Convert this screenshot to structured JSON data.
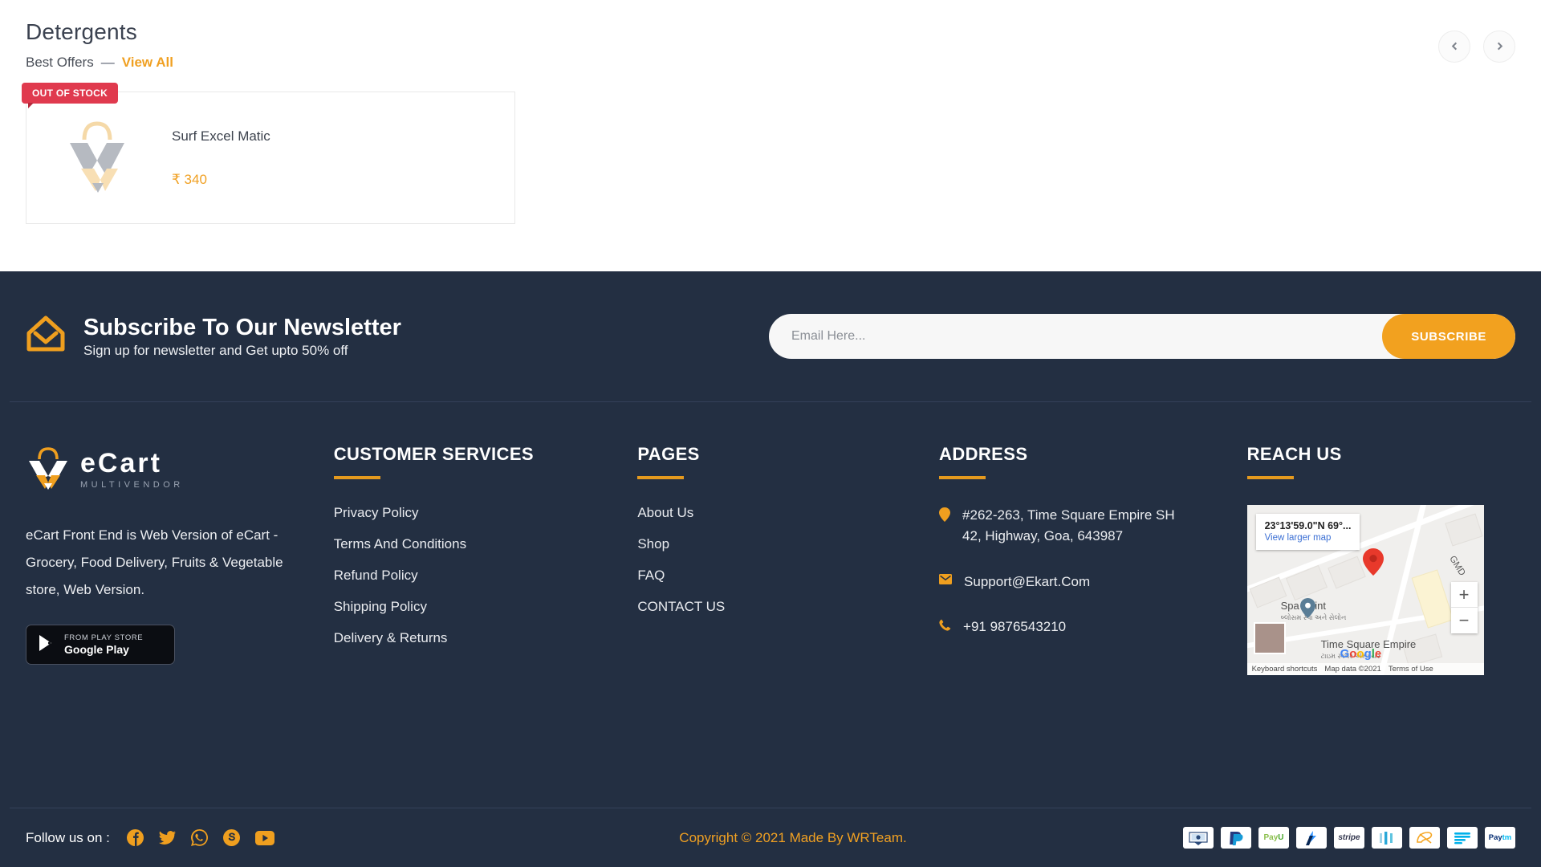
{
  "section": {
    "title": "Detergents",
    "subtitle": "Best Offers",
    "dash": "—",
    "view_all": "View All",
    "prev_label": "Previous",
    "next_label": "Next"
  },
  "products": [
    {
      "badge": "OUT OF STOCK",
      "name": "Surf Excel Matic",
      "price": "₹ 340"
    }
  ],
  "newsletter": {
    "title": "Subscribe To Our Newsletter",
    "subtitle": "Sign up for newsletter and Get upto 50% off",
    "placeholder": "Email Here...",
    "value": "",
    "button": "SUBSCRIBE"
  },
  "brand": {
    "name": "eCart",
    "tagline": "MULTIVENDOR",
    "description": "eCart Front End is Web Version of eCart - Grocery, Food Delivery, Fruits & Vegetable store, Web Version.",
    "play_small": "FROM PLAY STORE",
    "play_large": "Google Play"
  },
  "customer_services": {
    "heading": "CUSTOMER SERVICES",
    "links": [
      "Privacy Policy",
      "Terms And Conditions",
      "Refund Policy",
      "Shipping Policy",
      "Delivery & Returns"
    ]
  },
  "pages": {
    "heading": "PAGES",
    "links": [
      "About Us",
      "Shop",
      "FAQ",
      "CONTACT US"
    ]
  },
  "address": {
    "heading": "ADDRESS",
    "street": "#262-263, Time Square Empire SH 42, Highway, Goa, 643987",
    "email": "Support@Ekart.Com",
    "phone": "+91 9876543210"
  },
  "reach_us": {
    "heading": "REACH US",
    "map": {
      "coordinates": "23°13'59.0\"N 69°...",
      "view_larger": "View larger map",
      "place_label": "Time Square Empire",
      "place_label_local": "ટાઇમ સ્ક્વેર એમ્પાયર",
      "spa_label": "Spa Point",
      "spa_label_local": "બ્લોસમ સ્પા અને સેલોન",
      "road_label": "GMD",
      "zoom_in": "+",
      "zoom_out": "−",
      "keyboard_shortcuts": "Keyboard shortcuts",
      "map_data": "Map data ©2021",
      "terms": "Terms of Use",
      "google": "Google"
    }
  },
  "bottom": {
    "follow_label": "Follow us on :",
    "socials": [
      "facebook-icon",
      "twitter-icon",
      "whatsapp-icon",
      "skype-icon",
      "youtube-icon"
    ],
    "copyright_prefix": "Copyright © 2021 Made By ",
    "copyright_brand": "WRTeam.",
    "payments": [
      "cod",
      "paypal",
      "payu",
      "razorpay",
      "stripe",
      "paystack",
      "flutterwave",
      "mercadopago",
      "paytm"
    ]
  },
  "colors": {
    "accent": "#f0a022",
    "footer_bg": "#232f42",
    "danger": "#e03a4e"
  }
}
